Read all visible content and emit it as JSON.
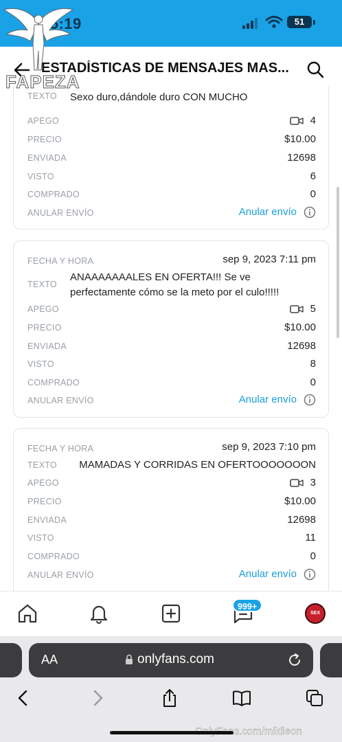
{
  "status": {
    "time": "15:19",
    "battery": "51"
  },
  "header": {
    "title": "ESTADÍSTICAS DE MENSAJES MAS..."
  },
  "watermark": {
    "site": "FAPEZA",
    "footer": "OnlyFans.com/mikileon"
  },
  "labels": {
    "fecha": "FECHA Y HORA",
    "texto": "TEXTO",
    "apego": "APEGO",
    "precio": "PRECIO",
    "enviada": "ENVIADA",
    "visto": "VISTO",
    "comprado": "COMPRADO",
    "anular": "ANULAR ENVÍO"
  },
  "cards": [
    {
      "fecha": "",
      "texto": "LOS VIDEOS MAS PORNO CON DESCUENTO!!! Sexo duro,dándole duro CON MUCHO DESCUENTO!",
      "apego": "4",
      "precio": "$10.00",
      "enviada": "12698",
      "visto": "6",
      "comprado": "0",
      "anular": "Anular envío"
    },
    {
      "fecha": "sep 9, 2023 7:11 pm",
      "texto": "ANAAAAAAALES EN OFERTA!!! Se ve perfectamente cómo se la meto por el culo!!!!!",
      "apego": "5",
      "precio": "$10.00",
      "enviada": "12698",
      "visto": "8",
      "comprado": "0",
      "anular": "Anular envío"
    },
    {
      "fecha": "sep 9, 2023 7:10 pm",
      "texto": "MAMADAS Y CORRIDAS EN OFERTOOOOOOON",
      "apego": "3",
      "precio": "$10.00",
      "enviada": "12698",
      "visto": "11",
      "comprado": "0",
      "anular": "Anular envío"
    }
  ],
  "nav": {
    "messages_badge": "999+",
    "avatar_text": "SEX"
  },
  "browser": {
    "aa": "AA",
    "url": "onlyfans.com"
  }
}
